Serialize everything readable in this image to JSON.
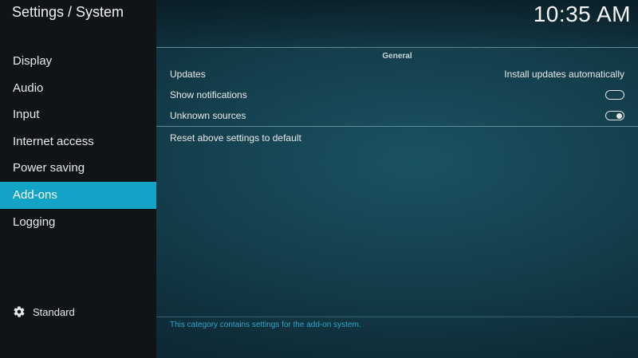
{
  "header": {
    "breadcrumb": "Settings / System",
    "clock": "10:35 AM"
  },
  "sidebar": {
    "items": [
      {
        "label": "Display"
      },
      {
        "label": "Audio"
      },
      {
        "label": "Input"
      },
      {
        "label": "Internet access"
      },
      {
        "label": "Power saving"
      },
      {
        "label": "Add-ons",
        "active": true
      },
      {
        "label": "Logging"
      }
    ],
    "level": {
      "label": "Standard",
      "icon": "gear-icon"
    }
  },
  "main": {
    "group_title": "General",
    "settings": [
      {
        "label": "Updates",
        "value": "Install updates automatically"
      },
      {
        "label": "Show notifications",
        "toggle": "off"
      },
      {
        "label": "Unknown sources",
        "toggle": "on"
      }
    ],
    "reset_label": "Reset above settings to default",
    "description": "This category contains settings for the add-on system."
  },
  "colors": {
    "accent": "#12a3c6",
    "sidebar_bg": "#101417",
    "description_text": "#2fa6c8"
  }
}
